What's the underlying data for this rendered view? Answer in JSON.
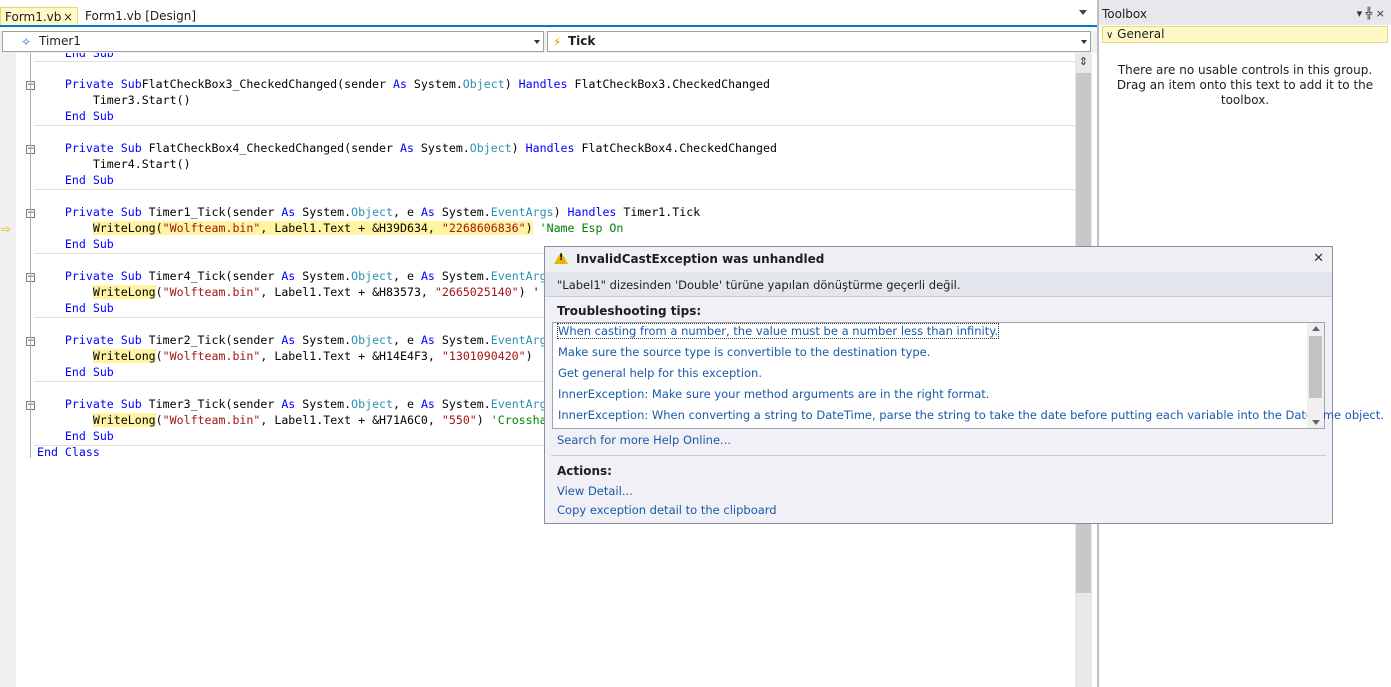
{
  "tabs": {
    "active": "Form1.vb",
    "inactive": "Form1.vb [Design]",
    "close_glyph": "×"
  },
  "nav": {
    "object_combo": "Timer1",
    "event_combo": "Tick"
  },
  "code": {
    "lines": [
      {
        "indent": "    ",
        "parts": [
          [
            "kw",
            "End Sub"
          ]
        ]
      },
      {
        "indent": "    ",
        "parts": [
          [
            "kw",
            "Private Sub"
          ],
          [
            "",
            "FlatCheckBox3_CheckedChanged(sender "
          ],
          [
            "kw",
            "As"
          ],
          [
            "",
            " System."
          ],
          [
            "ty",
            "Object"
          ],
          [
            "",
            ") "
          ],
          [
            "kw",
            "Handles"
          ],
          [
            "",
            " FlatCheckBox3.CheckedChanged"
          ]
        ]
      },
      {
        "indent": "        ",
        "parts": [
          [
            "",
            "Timer3.Start()"
          ]
        ]
      },
      {
        "indent": "    ",
        "parts": [
          [
            "kw",
            "End Sub"
          ]
        ]
      },
      {
        "indent": "    ",
        "parts": [
          [
            "kw",
            "Private Sub"
          ],
          [
            "",
            " FlatCheckBox4_CheckedChanged(sender "
          ],
          [
            "kw",
            "As"
          ],
          [
            "",
            " System."
          ],
          [
            "ty",
            "Object"
          ],
          [
            "",
            ") "
          ],
          [
            "kw",
            "Handles"
          ],
          [
            "",
            " FlatCheckBox4.CheckedChanged"
          ]
        ]
      },
      {
        "indent": "        ",
        "parts": [
          [
            "",
            "Timer4.Start()"
          ]
        ]
      },
      {
        "indent": "    ",
        "parts": [
          [
            "kw",
            "End Sub"
          ]
        ]
      },
      {
        "indent": "    ",
        "parts": [
          [
            "kw",
            "Private Sub"
          ],
          [
            "",
            " Timer1_Tick(sender "
          ],
          [
            "kw",
            "As"
          ],
          [
            "",
            " System."
          ],
          [
            "ty",
            "Object"
          ],
          [
            "",
            ", e "
          ],
          [
            "kw",
            "As"
          ],
          [
            "",
            " System."
          ],
          [
            "ty",
            "EventArgs"
          ],
          [
            "",
            ") "
          ],
          [
            "kw",
            "Handles"
          ],
          [
            "",
            " Timer1.Tick"
          ]
        ]
      },
      {
        "indent": "        ",
        "parts": [
          [
            "hl",
            "WriteLong(\"Wolfteam.bin\", Label1.Text + &H39D634, \"2268606836\")"
          ],
          [
            "",
            " "
          ],
          [
            "cm",
            "'Name Esp On"
          ]
        ]
      },
      {
        "indent": "    ",
        "parts": [
          [
            "kw",
            "End Sub"
          ]
        ]
      },
      {
        "indent": "    ",
        "parts": [
          [
            "kw",
            "Private Sub"
          ],
          [
            "",
            " Timer4_Tick(sender "
          ],
          [
            "kw",
            "As"
          ],
          [
            "",
            " System."
          ],
          [
            "ty",
            "Object"
          ],
          [
            "",
            ", e "
          ],
          [
            "kw",
            "As"
          ],
          [
            "",
            " System."
          ],
          [
            "ty",
            "EventArgs"
          ]
        ]
      },
      {
        "indent": "        ",
        "parts": [
          [
            "hlw",
            "WriteLong"
          ],
          [
            "",
            "(\"Wolfteam.bin\", Label1.Text + &H83573, \"2665025140\") '"
          ]
        ]
      },
      {
        "indent": "    ",
        "parts": [
          [
            "kw",
            "End Sub"
          ]
        ]
      },
      {
        "indent": "    ",
        "parts": [
          [
            "kw",
            "Private Sub"
          ],
          [
            "",
            " Timer2_Tick(sender "
          ],
          [
            "kw",
            "As"
          ],
          [
            "",
            " System."
          ],
          [
            "ty",
            "Object"
          ],
          [
            "",
            ", e "
          ],
          [
            "kw",
            "As"
          ],
          [
            "",
            " System."
          ],
          [
            "ty",
            "EventArgs"
          ]
        ]
      },
      {
        "indent": "        ",
        "parts": [
          [
            "hlw",
            "WriteLong"
          ],
          [
            "",
            "(\"Wolfteam.bin\", Label1.Text + &H14E4F3, \"1301090420\")"
          ]
        ]
      },
      {
        "indent": "    ",
        "parts": [
          [
            "kw",
            "End Sub"
          ]
        ]
      },
      {
        "indent": "    ",
        "parts": [
          [
            "kw",
            "Private Sub"
          ],
          [
            "",
            " Timer3_Tick(sender "
          ],
          [
            "kw",
            "As"
          ],
          [
            "",
            " System."
          ],
          [
            "ty",
            "Object"
          ],
          [
            "",
            ", e "
          ],
          [
            "kw",
            "As"
          ],
          [
            "",
            " System."
          ],
          [
            "ty",
            "EventArgs"
          ]
        ]
      },
      {
        "indent": "        ",
        "parts": [
          [
            "hlw",
            "WriteLong"
          ],
          [
            "",
            "(\"Wolfteam.bin\", Label1.Text + &H71A6C0, \"550\") "
          ],
          [
            "cm",
            "'Crossha"
          ]
        ]
      },
      {
        "indent": "    ",
        "parts": [
          [
            "kw",
            "End Sub"
          ]
        ]
      },
      {
        "indent": "",
        "parts": [
          [
            "kw",
            "End Class"
          ]
        ]
      }
    ]
  },
  "toolbox": {
    "title": "Toolbox",
    "pin_glyph": "▾ ╬ ×",
    "group": "General",
    "message": "There are no usable controls in this group. Drag an item onto this text to add it to the toolbox."
  },
  "exception": {
    "title": "InvalidCastException was unhandled",
    "message": "\"Label1\" dizesinden 'Double' türüne yapılan dönüştürme geçerli değil.",
    "tips_label": "Troubleshooting tips:",
    "tips": [
      "When casting from a number, the value must be a number less than infinity.",
      "Make sure the source type is convertible to the destination type.",
      "Get general help for this exception.",
      "InnerException: Make sure your method arguments are in the right format.",
      "InnerException: When converting a string to DateTime, parse the string to take the date before putting each variable into the DateTime object."
    ],
    "search_link": "Search for more Help Online...",
    "actions_label": "Actions:",
    "view_detail": "View Detail...",
    "copy_detail": "Copy exception detail to the clipboard"
  },
  "colors": {
    "keyword": "#0000ff",
    "type": "#2b91af",
    "string": "#a31515",
    "comment": "#008000",
    "link": "#1a5aa8",
    "highlight": "#fff4a0",
    "accent": "#007acc"
  },
  "icons": {
    "exec_arrow": "⇨",
    "warning": "warning-icon"
  }
}
